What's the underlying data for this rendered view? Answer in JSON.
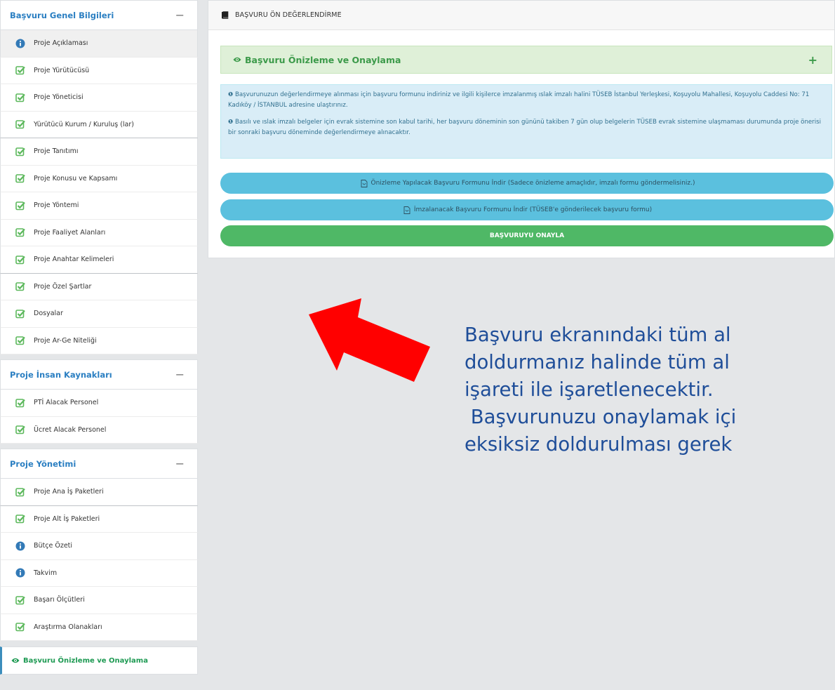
{
  "sidebar": {
    "sections": [
      {
        "title": "Başvuru Genel Bilgileri",
        "items": [
          {
            "label": "Proje Açıklaması",
            "icon": "info-icon"
          },
          {
            "label": "Proje Yürütücüsü",
            "icon": "check-icon"
          },
          {
            "label": "Proje Yöneticisi",
            "icon": "check-icon"
          },
          {
            "label": "Yürütücü Kurum / Kuruluş (lar)",
            "icon": "check-icon"
          },
          {
            "label": "Proje Tanıtımı",
            "icon": "check-icon"
          },
          {
            "label": "Proje Konusu ve Kapsamı",
            "icon": "check-icon"
          },
          {
            "label": "Proje Yöntemi",
            "icon": "check-icon"
          },
          {
            "label": "Proje Faaliyet Alanları",
            "icon": "check-icon"
          },
          {
            "label": "Proje Anahtar Kelimeleri",
            "icon": "check-icon"
          },
          {
            "label": "Proje Özel Şartlar",
            "icon": "check-icon"
          },
          {
            "label": "Dosyalar",
            "icon": "check-icon"
          },
          {
            "label": "Proje Ar-Ge Niteliği",
            "icon": "check-icon"
          }
        ]
      },
      {
        "title": "Proje İnsan Kaynakları",
        "items": [
          {
            "label": "PTİ Alacak Personel",
            "icon": "check-icon"
          },
          {
            "label": "Ücret Alacak Personel",
            "icon": "check-icon"
          }
        ]
      },
      {
        "title": "Proje Yönetimi",
        "items": [
          {
            "label": "Proje Ana İş Paketleri",
            "icon": "check-icon"
          },
          {
            "label": "Proje Alt İş Paketleri",
            "icon": "check-icon"
          },
          {
            "label": "Bütçe Özeti",
            "icon": "info-icon"
          },
          {
            "label": "Takvim",
            "icon": "info-icon"
          },
          {
            "label": "Başarı Ölçütleri",
            "icon": "check-icon"
          },
          {
            "label": "Araştırma Olanakları",
            "icon": "check-icon"
          }
        ]
      }
    ],
    "collapse_symbol": "−",
    "active_item": {
      "label": "Başvuru Önizleme ve Onaylama",
      "icon": "eye-icon"
    }
  },
  "main": {
    "header": {
      "label": "BAŞVURU ÖN DEĞERLENDİRME",
      "icon": "book-icon"
    },
    "preview": {
      "title": "Başvuru Önizleme ve Onaylama",
      "expand_symbol": "+"
    },
    "info": {
      "p1": "Başvurunuzun değerlendirmeye alınması için başvuru formunu indiriniz ve ilgili kişilerce imzalanmış ıslak imzalı halini TÜSEB İstanbul Yerleşkesi, Koşuyolu Mahallesi, Koşuyolu Caddesi No: 71 Kadıköy / İSTANBUL adresine ulaştırınız.",
      "p2": "Basılı ve ıslak imzalı belgeler için evrak sistemine son kabul tarihi, her başvuru döneminin son gününü takiben 7 gün olup belgelerin TÜSEB evrak sistemine ulaşmaması durumunda proje önerisi bir sonraki başvuru döneminde değerlendirmeye alınacaktır."
    },
    "buttons": {
      "preview_download": "Önizleme Yapılacak Başvuru Formunu İndir (Sadece önizleme amaçlıdır, imzalı formu göndermelisiniz.)",
      "signed_download": "İmzalanacak Başvuru Formunu İndir (TÜSEB'e gönderilecek başvuru formu)",
      "approve": "BAŞVURUYU ONAYLA"
    }
  },
  "annotation": {
    "lines": [
      "Başvuru ekranındaki tüm al",
      "doldurmanız halinde tüm al",
      "işareti ile işaretlenecektir.",
      " Başvurunuzu onaylamak içi",
      "eksiksiz doldurulması gerek"
    ],
    "arrow_color": "#ff0000"
  },
  "colors": {
    "link_blue": "#2b7fc2",
    "check_green": "#5cb85c",
    "info_blue": "#337ab7",
    "approve_green": "#4fb866",
    "download_blue": "#5bc0de"
  }
}
